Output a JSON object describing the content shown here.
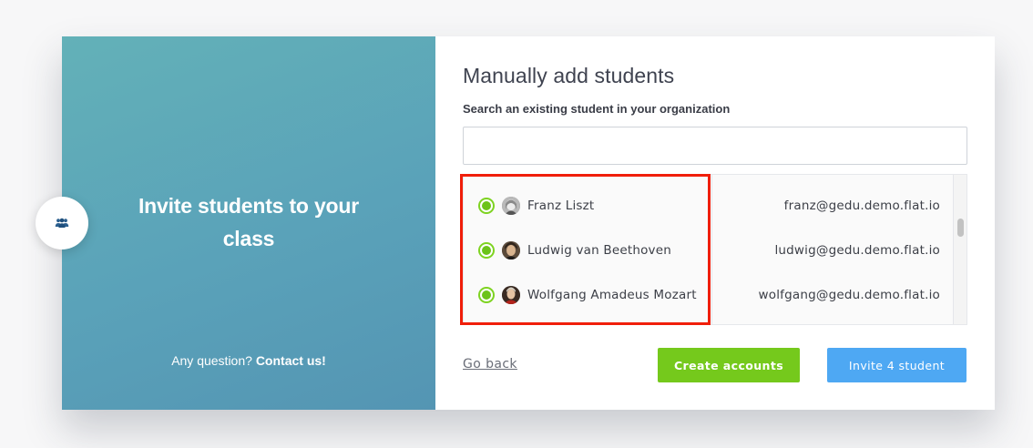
{
  "left_panel": {
    "title": "Invite students to your class",
    "footer_question": "Any question?",
    "footer_link": "Contact us!"
  },
  "bubble": {
    "icon": "people-icon"
  },
  "right_panel": {
    "title": "Manually add students",
    "search_label": "Search an existing student in your organization",
    "search_value": "",
    "search_placeholder": ""
  },
  "students": [
    {
      "name": "Franz Liszt",
      "email": "franz@gedu.demo.flat.io",
      "selected": true
    },
    {
      "name": "Ludwig van Beethoven",
      "email": "ludwig@gedu.demo.flat.io",
      "selected": true
    },
    {
      "name": "Wolfgang Amadeus Mozart",
      "email": "wolfgang@gedu.demo.flat.io",
      "selected": true
    }
  ],
  "actions": {
    "go_back": "Go back",
    "create_accounts": "Create accounts",
    "invite": "Invite 4 student"
  },
  "colors": {
    "accent_green": "#75c91c",
    "accent_blue": "#4ea8f3",
    "highlight_red": "#f01e0a",
    "panel_teal": "#5aa2b9"
  }
}
